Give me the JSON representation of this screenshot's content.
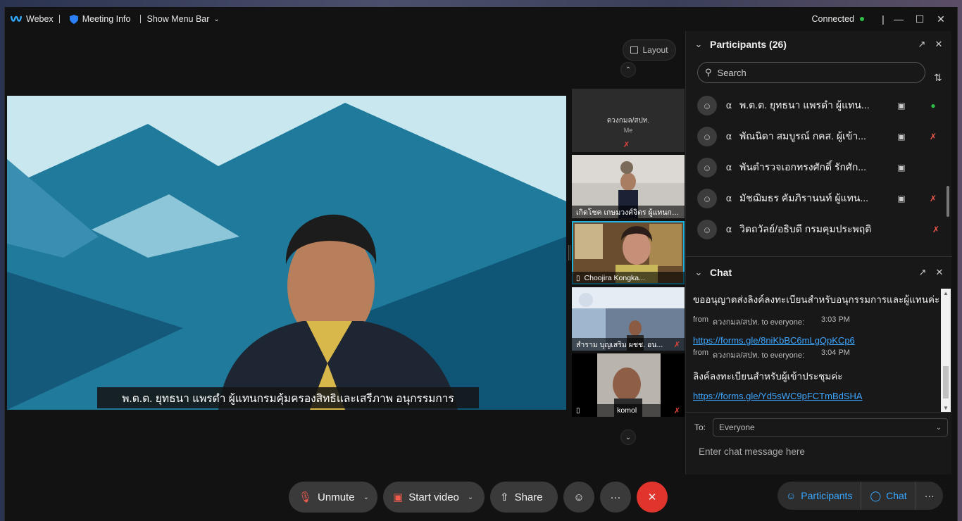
{
  "titlebar": {
    "app": "Webex",
    "meeting_info": "Meeting Info",
    "show_menu_bar": "Show Menu Bar",
    "status": "Connected"
  },
  "stage": {
    "layout_label": "Layout",
    "caption": "พ.ต.ต. ยุทธนา แพรดำ ผู้แทนกรมคุ้มครองสิทธิและเสรีภาพ อนุกรรมการ"
  },
  "thumbnails": [
    {
      "name": "ดวงกมล/สปท.",
      "sub": "Me",
      "muted": true
    },
    {
      "name": "เกิดโชค เกษมวงศ์จิตร ผู้แทนกร...",
      "muted": false
    },
    {
      "name": "Choojira Kongka...",
      "muted": false,
      "active": true
    },
    {
      "name": "สำราม บุญเสริม ผชช. อน...",
      "muted": true
    },
    {
      "name": "komol",
      "muted": true
    }
  ],
  "controls": {
    "unmute": "Unmute",
    "start_video": "Start video",
    "share": "Share"
  },
  "right_controls": {
    "participants": "Participants",
    "chat": "Chat"
  },
  "participants": {
    "title": "Participants (26)",
    "search_placeholder": "Search",
    "rows": [
      {
        "name": "พ.ต.ต. ยุทธนา แพรดำ ผู้แทน...",
        "video": true,
        "mic": "on"
      },
      {
        "name": "พัณนิดา สมบูรณ์ กคส. ผู้เข้า...",
        "video": true,
        "mic": "muted"
      },
      {
        "name": "พันตำรวจเอกทรงศักดิ์ รักศัก...",
        "video": true,
        "mic": ""
      },
      {
        "name": "มัชฌิมธร คัมภิรานนท์ ผู้แทน...",
        "video": true,
        "mic": "muted"
      },
      {
        "name": "วิตถวัลย์/อธิบดี กรมคุมประพฤติ",
        "video": false,
        "mic": "muted"
      }
    ]
  },
  "chat": {
    "title": "Chat",
    "messages": [
      {
        "text": "ขออนุญาตส่งลิงค์ลงทะเบียนสำหรับอนุกรรมการและผู้แทนค่ะ"
      },
      {
        "from": "from",
        "sender": "ดวงกมล/สปท. to everyone:",
        "time": "3:03 PM",
        "link": "https://forms.gle/8niKbBC6mLgQpKCp6"
      },
      {
        "from": "from",
        "sender": "ดวงกมล/สปท. to everyone:",
        "time": "3:04 PM",
        "text": "ลิงค์ลงทะเบียนสำหรับผู้เข้าประชุมค่ะ",
        "link": "https://forms.gle/Yd5sWC9pFCTmBdSHA"
      }
    ],
    "to_label": "To:",
    "to_value": "Everyone",
    "input_placeholder": "Enter chat message here"
  }
}
